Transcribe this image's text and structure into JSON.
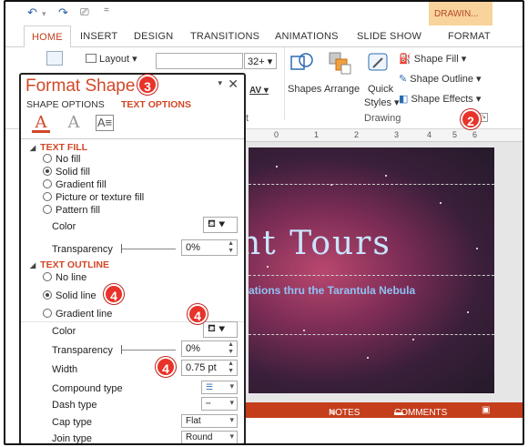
{
  "qat": {
    "undo_icon": "undo-icon",
    "redo_icon": "redo-icon",
    "present_icon": "present-icon",
    "more": "="
  },
  "contextual_tab_group": "DRAWIN...",
  "tabs": [
    "HOME",
    "INSERT",
    "DESIGN",
    "TRANSITIONS",
    "ANIMATIONS",
    "SLIDE SHOW",
    "FORMAT"
  ],
  "ribbon": {
    "layout_label": "Layout",
    "font_size": "32+",
    "shapes_label": "Shapes",
    "arrange_label": "Arrange",
    "quick_styles_label": "Quick",
    "quick_styles_label2": "Styles",
    "shape_fill": "Shape Fill",
    "shape_outline": "Shape Outline",
    "shape_effects": "Shape Effects",
    "drawing_group": "Drawing",
    "partial_group_t": "t",
    "av_label": "AV"
  },
  "pane": {
    "title": "Format Shape",
    "tab_shape": "SHAPE OPTIONS",
    "tab_text": "TEXT OPTIONS",
    "text_fill": {
      "heading": "TEXT FILL",
      "options": [
        "No fill",
        "Solid fill",
        "Gradient fill",
        "Picture or texture fill",
        "Pattern fill"
      ],
      "selected": 1,
      "color_label": "Color",
      "transparency_label": "Transparency",
      "transparency_value": "0%"
    },
    "text_outline": {
      "heading": "TEXT OUTLINE",
      "options": [
        "No line",
        "Solid line",
        "Gradient line"
      ],
      "selected": 1,
      "color_label": "Color",
      "transparency_label": "Transparency",
      "transparency_value": "0%",
      "width_label": "Width",
      "width_value": "0.75 pt",
      "compound_label": "Compound type",
      "dash_label": "Dash type",
      "cap_label": "Cap type",
      "cap_value": "Flat",
      "join_label": "Join type",
      "join_value": "Round"
    }
  },
  "slide": {
    "title": "ht Tours",
    "subtitle": "ations thru the Tarantula Nebula"
  },
  "ruler_ticks": [
    "0",
    "1",
    "2",
    "3",
    "4",
    "5",
    "6"
  ],
  "statusbar": {
    "notes": "NOTES",
    "comments": "COMMENTS"
  },
  "badges": {
    "b2": "2",
    "b3": "3",
    "b4": "4"
  },
  "colors": {
    "accent": "#d24726",
    "badge": "#e8322a",
    "statusbar": "#c43e1c"
  }
}
